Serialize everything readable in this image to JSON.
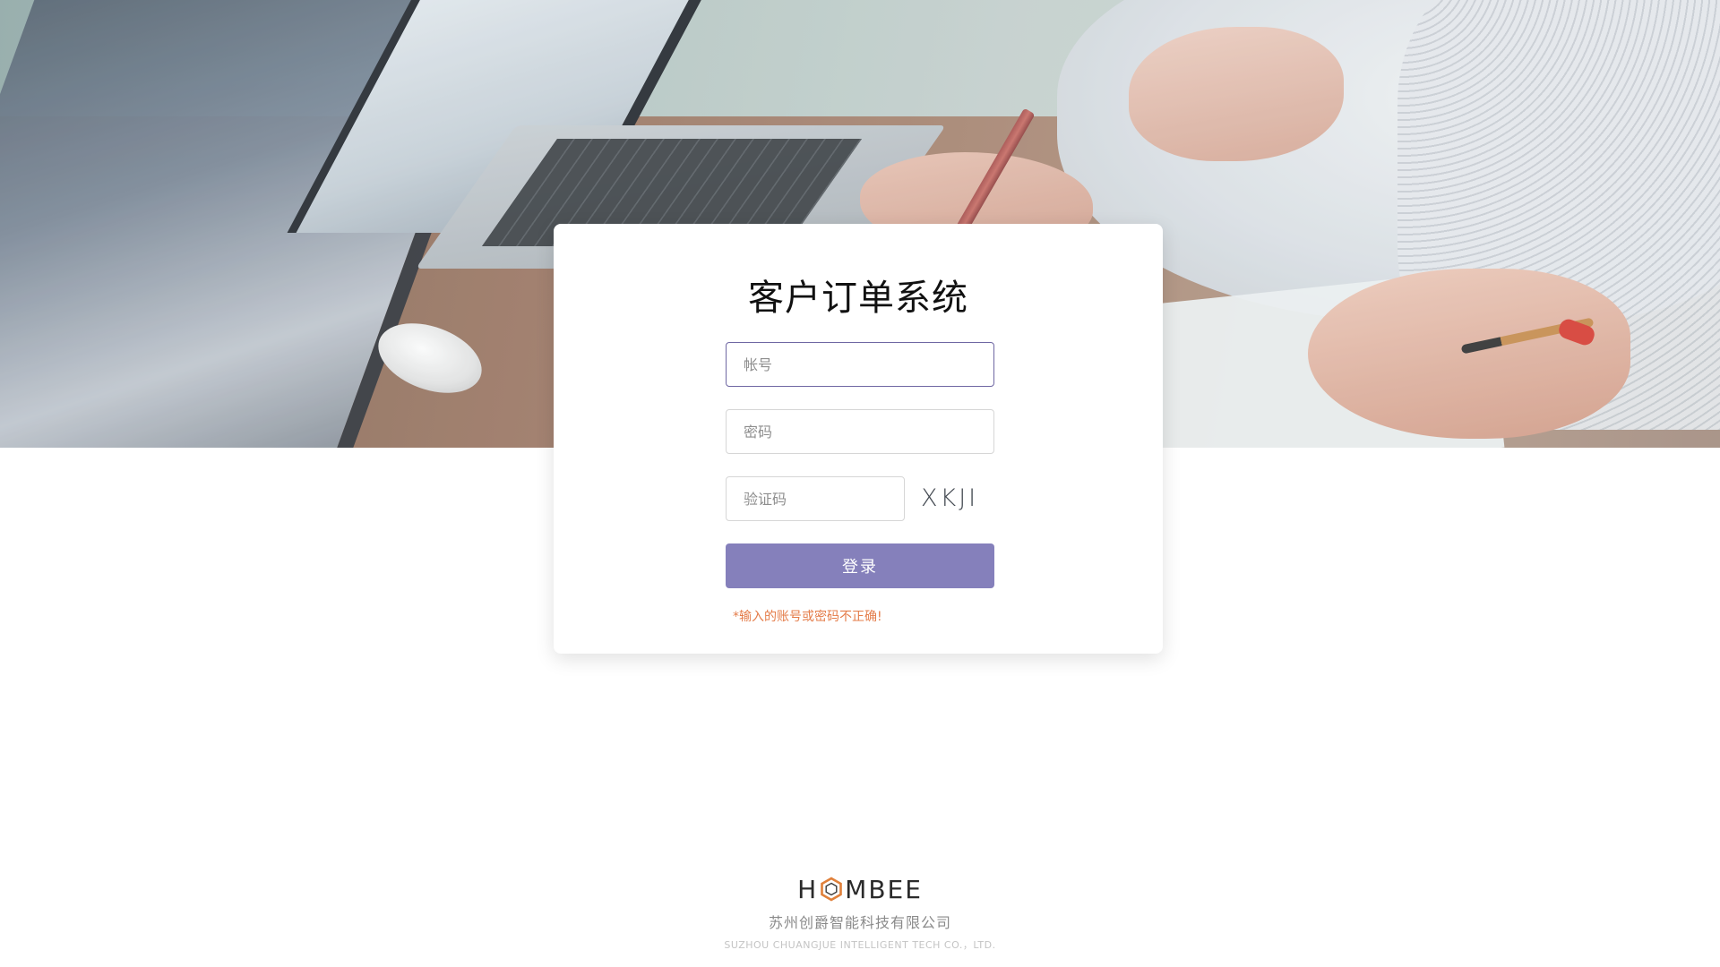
{
  "login": {
    "title": "客户订单系统",
    "username_placeholder": "帐号",
    "password_placeholder": "密码",
    "captcha_placeholder": "验证码",
    "captcha_text": "XKJI",
    "submit_label": "登录",
    "error_message": "*输入的账号或密码不正确!"
  },
  "footer": {
    "brand_prefix": "H",
    "brand_suffix": "MBEE",
    "company_name_cn": "苏州创爵智能科技有限公司",
    "company_name_en": "SUZHOU CHUANGJUE INTELLIGENT TECH CO.，LTD."
  },
  "colors": {
    "accent": "#8580bb",
    "input_focus_border": "#6f67a3",
    "error": "#e47c49",
    "logo_orange": "#e0803a"
  },
  "icons": {
    "brand_logo": "hexagon-icon"
  }
}
